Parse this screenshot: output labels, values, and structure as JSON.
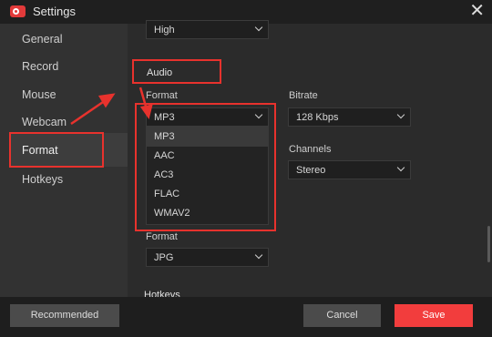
{
  "window": {
    "title": "Settings"
  },
  "sidebar": {
    "items": [
      {
        "label": "General"
      },
      {
        "label": "Record"
      },
      {
        "label": "Mouse"
      },
      {
        "label": "Webcam"
      },
      {
        "label": "Format"
      },
      {
        "label": "Hotkeys"
      }
    ],
    "active": "Format"
  },
  "video": {
    "quality_value": "High"
  },
  "audio": {
    "section_title": "Audio",
    "format_label": "Format",
    "format_value": "MP3",
    "format_options": [
      "MP3",
      "AAC",
      "AC3",
      "FLAC",
      "WMAV2"
    ],
    "bitrate_label": "Bitrate",
    "bitrate_value": "128 Kbps",
    "channels_label": "Channels",
    "channels_value": "Stereo"
  },
  "screenshot": {
    "format_label": "Format",
    "format_value": "JPG"
  },
  "hotkeys_section": {
    "title": "Hotkeys"
  },
  "footer": {
    "recommended_label": "Recommended",
    "cancel_label": "Cancel",
    "save_label": "Save"
  },
  "colors": {
    "accent": "#f23d3d",
    "annotation": "#e8322d"
  }
}
